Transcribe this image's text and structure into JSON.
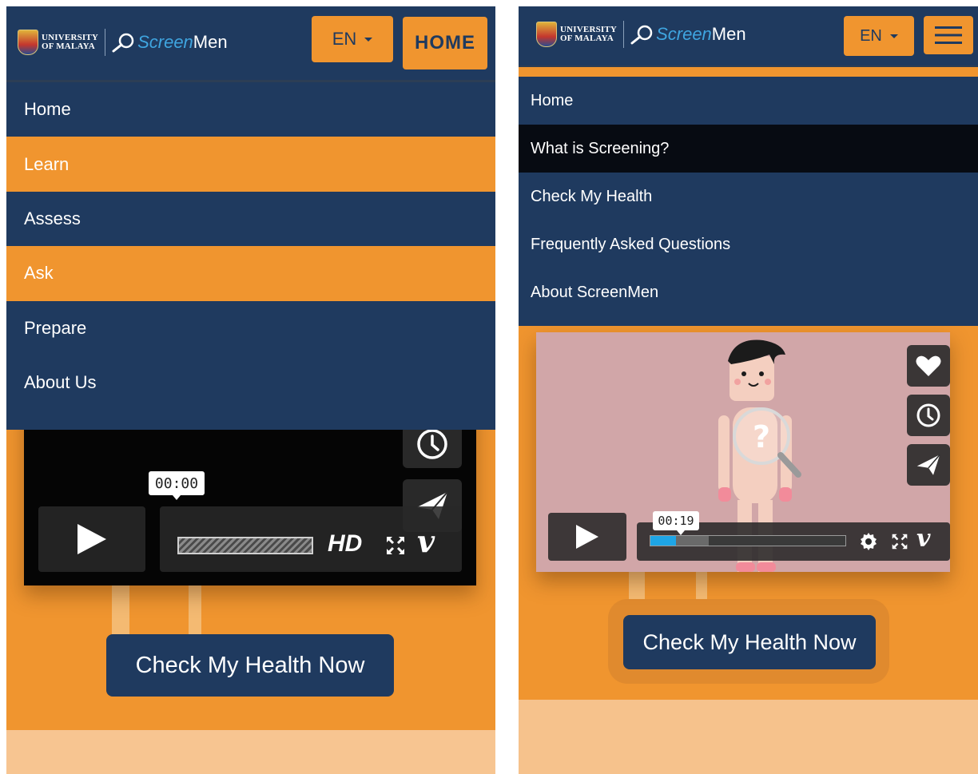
{
  "left": {
    "header": {
      "university_text_line1": "UNIVERSITY",
      "university_text_line2": "OF MALAYA",
      "brand_screen": "Screen",
      "brand_men": "Men",
      "language_label": "EN",
      "home_label": "HOME"
    },
    "nav": {
      "items": [
        {
          "label": "Home"
        },
        {
          "label": "Learn"
        },
        {
          "label": "Assess"
        },
        {
          "label": "Ask"
        },
        {
          "label": "Prepare"
        },
        {
          "label": "About Us"
        }
      ]
    },
    "video": {
      "time": "00:00",
      "hd_label": "HD",
      "vimeo_label": "v"
    },
    "cta_label": "Check My Health Now"
  },
  "right": {
    "header": {
      "university_text_line1": "UNIVERSITY",
      "university_text_line2": "OF MALAYA",
      "brand_screen": "Screen",
      "brand_men": "Men",
      "language_label": "EN"
    },
    "nav": {
      "items": [
        {
          "label": "Home"
        },
        {
          "label": "What is Screening?"
        },
        {
          "label": "Check My Health"
        },
        {
          "label": "Frequently Asked Questions"
        },
        {
          "label": "About ScreenMen"
        }
      ]
    },
    "video": {
      "time": "00:19",
      "progress_fraction": 0.13,
      "buffered_fraction": 0.3,
      "vimeo_label": "v"
    },
    "cta_label": "Check My Health Now"
  },
  "icons": {
    "heart": "heart-icon",
    "clock": "clock-icon",
    "send": "paper-plane-icon",
    "fullscreen": "fullscreen-icon",
    "settings": "gear-icon",
    "menu": "hamburger-menu-icon",
    "play": "play-icon"
  },
  "colors": {
    "navy": "#1f3a5f",
    "orange": "#f0952f",
    "progress_blue": "#1ea5e6"
  }
}
